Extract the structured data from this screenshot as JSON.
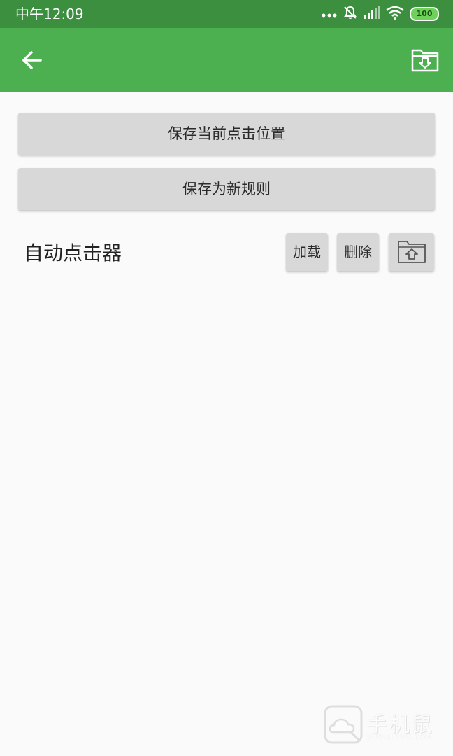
{
  "status_bar": {
    "time": "中午12:09",
    "battery": "100",
    "icons": [
      "more-dots-icon",
      "mute-bell-icon",
      "signal-icon",
      "wifi-icon",
      "battery-icon"
    ]
  },
  "app_bar": {
    "back_icon": "arrow-left-icon",
    "action_icon": "folder-download-icon"
  },
  "buttons": {
    "save_current_click": "保存当前点击位置",
    "save_new_rule": "保存为新规则",
    "load": "加载",
    "delete": "删除",
    "upload_icon": "folder-upload-icon"
  },
  "rule": {
    "name": "自动点击器"
  },
  "watermark": {
    "text": "手机鼠",
    "sub": "SHOUJISHU.COM"
  },
  "colors": {
    "status_bar": "#3b8f3f",
    "app_bar": "#4caf50",
    "button": "#d8d8d8",
    "background": "#fafafa"
  }
}
